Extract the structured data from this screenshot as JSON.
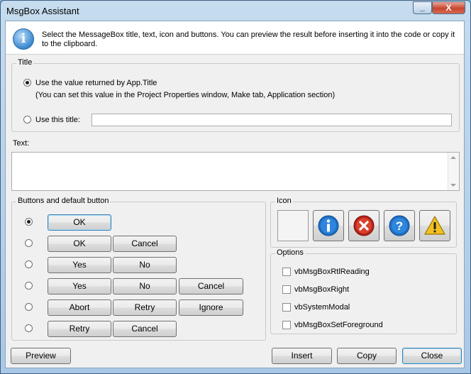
{
  "window": {
    "title": "MsgBox Assistant",
    "minimize_glyph": "_",
    "close_glyph": "X"
  },
  "header": {
    "icon": "info-icon",
    "description": "Select the MessageBox title, text, icon and buttons. You can preview the result before inserting it into the code or copy it to the clipboard."
  },
  "title_group": {
    "legend": "Title",
    "option_app_title": "Use the value returned by App.Title",
    "option_app_title_note": "(You can set this value in the Project Properties window, Make tab, Application section)",
    "option_custom": "Use this title:",
    "custom_value": "",
    "selected": "app_title"
  },
  "text_section": {
    "label": "Text:",
    "value": ""
  },
  "buttons_group": {
    "legend": "Buttons and default button",
    "rows": [
      {
        "buttons": [
          "OK"
        ],
        "selected": true
      },
      {
        "buttons": [
          "OK",
          "Cancel"
        ],
        "selected": false
      },
      {
        "buttons": [
          "Yes",
          "No"
        ],
        "selected": false
      },
      {
        "buttons": [
          "Yes",
          "No",
          "Cancel"
        ],
        "selected": false
      },
      {
        "buttons": [
          "Abort",
          "Retry",
          "Ignore"
        ],
        "selected": false
      },
      {
        "buttons": [
          "Retry",
          "Cancel"
        ],
        "selected": false
      }
    ]
  },
  "icon_group": {
    "legend": "Icon",
    "icons": [
      "none",
      "information-icon",
      "critical-icon",
      "question-icon",
      "exclamation-icon"
    ],
    "selected": "none"
  },
  "options_group": {
    "legend": "Options",
    "items": [
      {
        "label": "vbMsgBoxRtlReading",
        "checked": false
      },
      {
        "label": "vbMsgBoxRight",
        "checked": false
      },
      {
        "label": "vbSystemModal",
        "checked": false
      },
      {
        "label": "vbMsgBoxSetForeground",
        "checked": false
      }
    ]
  },
  "footer": {
    "preview": "Preview",
    "insert": "Insert",
    "copy": "Copy",
    "close": "Close"
  },
  "colors": {
    "accent": "#3c7fb1",
    "info_blue": "#1f6fc4",
    "error_red": "#d03020",
    "warning_yellow": "#f2c01e"
  }
}
